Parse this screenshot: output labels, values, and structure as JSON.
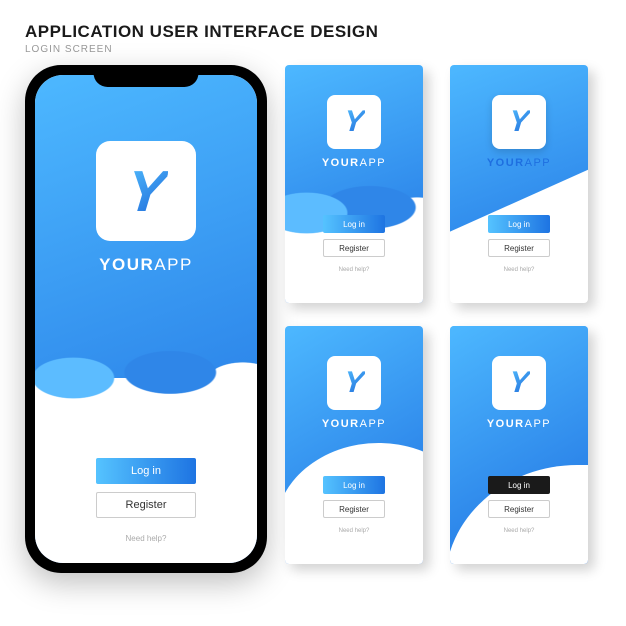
{
  "header": {
    "title": "APPLICATION USER INTERFACE DESIGN",
    "subtitle": "LOGIN SCREEN"
  },
  "brand": {
    "part1": "YOUR",
    "part2": "APP"
  },
  "buttons": {
    "login": "Log in",
    "register": "Register"
  },
  "help": "Need help?"
}
